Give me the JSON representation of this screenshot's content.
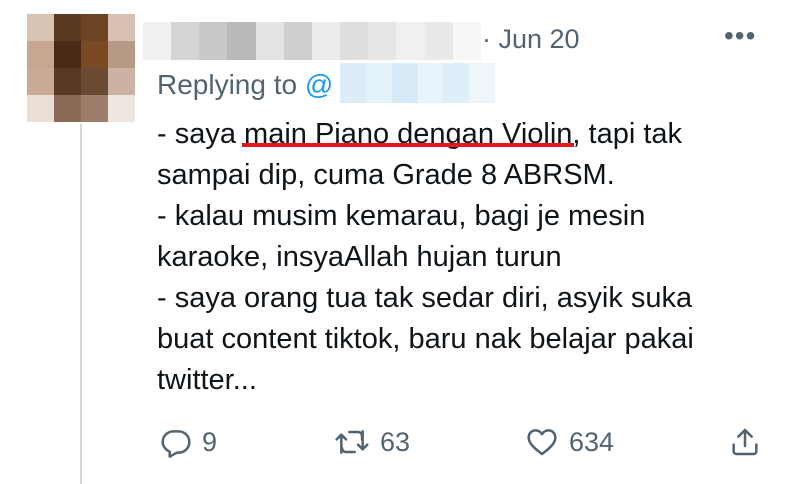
{
  "tweet": {
    "date": "· Jun 20",
    "more_label": "•••",
    "replying_prefix": "Replying to",
    "replying_handle": "@",
    "body": {
      "line1_pre": "- saya ",
      "line1_highlight": "main Piano dengan Violin",
      "line1_post": ", tapi tak",
      "line2": "sampai dip, cuma Grade 8 ABRSM.",
      "line3": "- kalau musim kemarau, bagi je mesin",
      "line4": "karaoke, insyaAllah hujan turun",
      "line5": "- saya orang tua tak sedar diri, asyik suka",
      "line6": "buat content tiktok, baru nak belajar pakai",
      "line7": "twitter..."
    },
    "actions": {
      "reply_count": "9",
      "retweet_count": "63",
      "like_count": "634"
    },
    "icons": {
      "reply": "reply-icon",
      "retweet": "retweet-icon",
      "like": "heart-icon",
      "share": "share-icon",
      "more": "more-icon"
    },
    "colors": {
      "text": "#0f1419",
      "secondary": "#536471",
      "link": "#1d9bf0",
      "highlight_underline": "#e8131c",
      "thread_line": "#cfd9de"
    }
  }
}
